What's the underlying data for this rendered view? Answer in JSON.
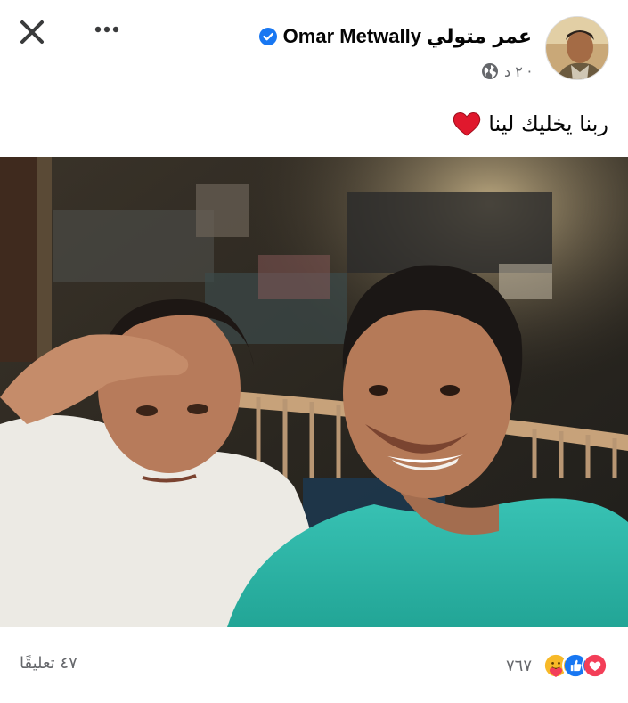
{
  "header": {
    "author_name_ar": "عمر متولي",
    "author_name_en": "Omar Metwally",
    "time_ago": "٢ د ·",
    "privacy_icon": "globe-icon",
    "close_icon": "close-icon",
    "more_icon": "more-horizontal-icon"
  },
  "post": {
    "caption": "ربنا يخليك لينا",
    "caption_emoji": "red-heart"
  },
  "footer": {
    "comments_count_label": "٤٧ تعليقًا",
    "reactions_count": "٧٦٧",
    "reaction_icons": [
      "care-icon",
      "like-icon",
      "love-icon"
    ]
  },
  "colors": {
    "verified_blue": "#1877f2",
    "like_blue": "#1877f2",
    "love_red": "#f33e58",
    "secondary_text": "#65676b"
  }
}
